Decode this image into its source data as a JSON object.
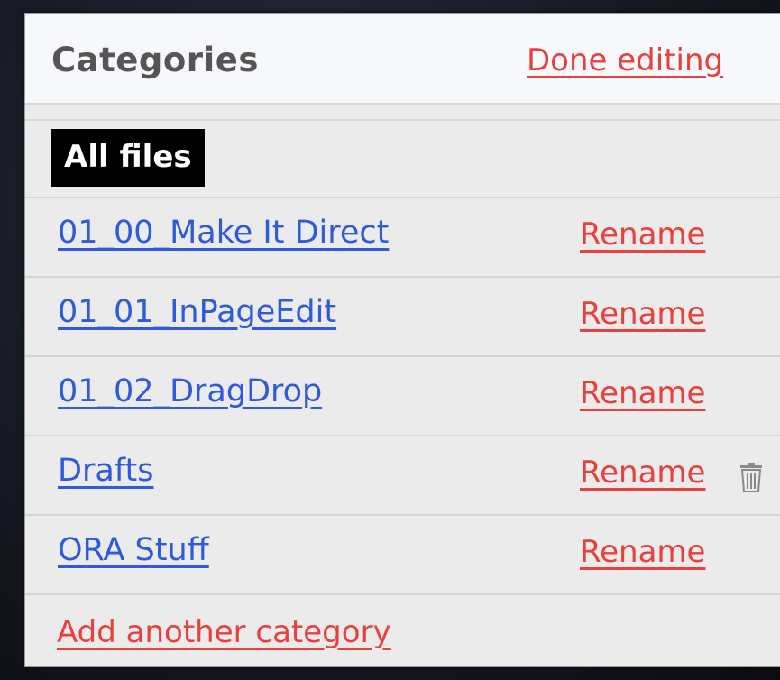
{
  "header": {
    "title": "Categories",
    "done_label": "Done editing"
  },
  "all_files_label": "All files",
  "categories": [
    {
      "name": "01_00_Make It Direct",
      "rename_label": "Rename"
    },
    {
      "name": "01_01_InPageEdit",
      "rename_label": "Rename"
    },
    {
      "name": "01_02_DragDrop",
      "rename_label": "Rename"
    },
    {
      "name": "Drafts",
      "rename_label": "Rename",
      "delete_icon": "trash-icon"
    },
    {
      "name": "ORA Stuff",
      "rename_label": "Rename"
    }
  ],
  "add_label": "Add another category",
  "colors": {
    "link_blue": "#2f5ad8",
    "action_red": "#e8403c",
    "selected_bg": "#000000"
  }
}
